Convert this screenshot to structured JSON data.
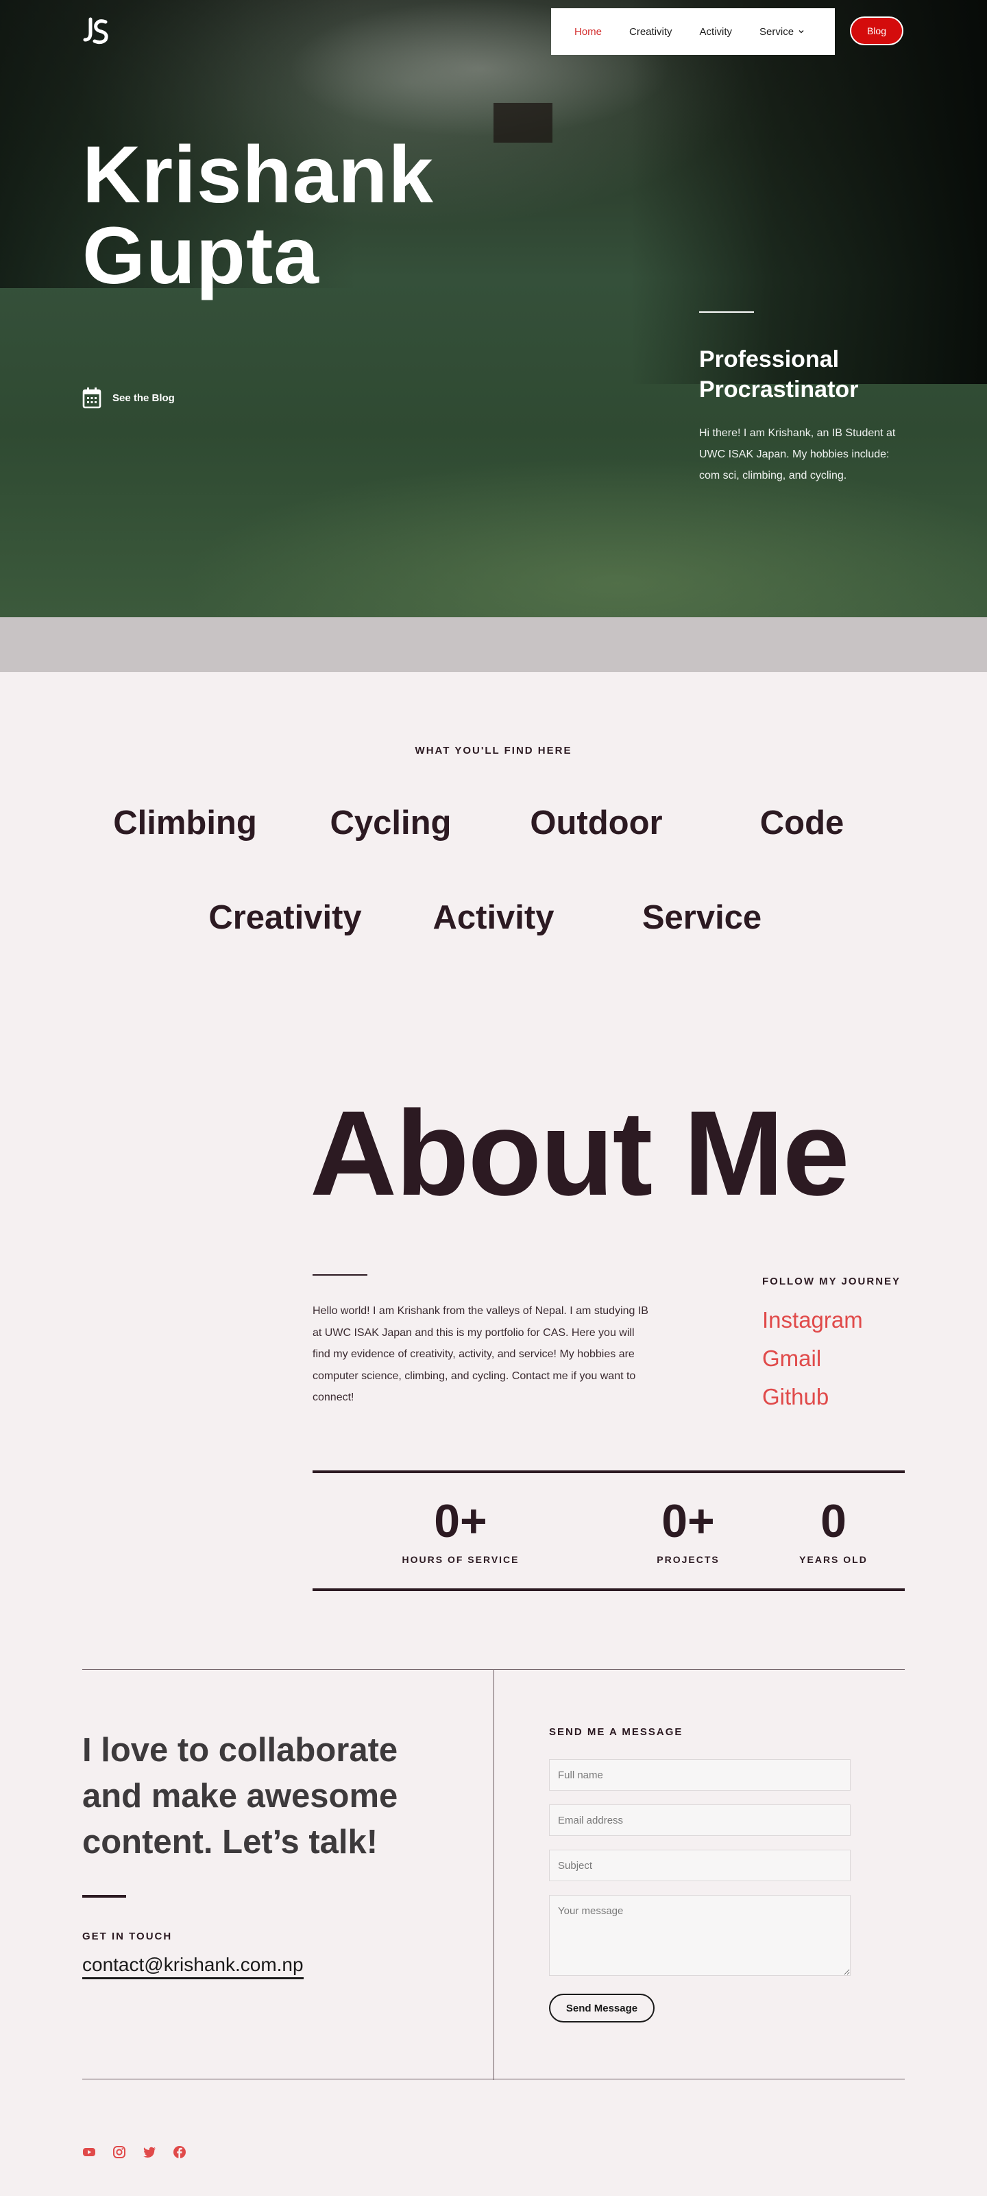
{
  "nav": {
    "items": [
      "Home",
      "Creativity",
      "Activity",
      "Service"
    ],
    "active": "Home",
    "blog_label": "Blog"
  },
  "hero": {
    "title_line1": "Krishank",
    "title_line2": "Gupta",
    "see_blog": "See the Blog",
    "heading_line1": "Professional",
    "heading_line2": "Procrastinator",
    "intro": "Hi there! I am Krishank, an IB Student at UWC ISAK Japan. My hobbies include: com sci, climbing, and cycling."
  },
  "topics": {
    "label": "WHAT YOU'LL FIND HERE",
    "row1": [
      "Climbing",
      "Cycling",
      "Outdoor",
      "Code"
    ],
    "row2": [
      "Creativity",
      "Activity",
      "Service"
    ]
  },
  "about": {
    "title": "About Me",
    "text": "Hello world! I am Krishank from the valleys of Nepal. I am studying IB at UWC ISAK Japan and this is my portfolio for CAS. Here you will find my evidence of creativity, activity, and service! My hobbies are computer science, climbing, and cycling. Contact me if you want to connect!",
    "follow_label": "FOLLOW MY JOURNEY",
    "links": [
      "Instagram",
      "Gmail",
      "Github"
    ]
  },
  "stats": [
    {
      "value": "0+",
      "label": "HOURS OF SERVICE"
    },
    {
      "value": "0+",
      "label": "PROJECTS"
    },
    {
      "value": "0",
      "label": "YEARS OLD"
    }
  ],
  "contact": {
    "heading": "I love to collaborate and make awesome content. Let’s talk!",
    "get_in_touch": "GET IN TOUCH",
    "email": "contact@krishank.com.np",
    "send_label": "SEND ME A MESSAGE",
    "placeholders": {
      "name": "Full name",
      "email": "Email address",
      "subject": "Subject",
      "message": "Your message"
    },
    "button": "Send Message"
  },
  "footer": {
    "icons": [
      "youtube-icon",
      "instagram-icon",
      "twitter-icon",
      "facebook-icon"
    ]
  },
  "colors": {
    "accent": "#d40c0c",
    "link": "#e04a4a",
    "text": "#2c1a22",
    "background": "#f5f0f1",
    "band": "#c8c3c4"
  }
}
